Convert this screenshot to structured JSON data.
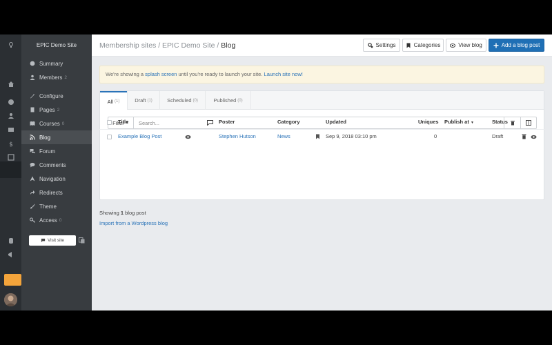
{
  "site": {
    "name": "EPIC Demo Site"
  },
  "breadcrumb": {
    "root": "Membership sites",
    "site": "EPIC Demo Site",
    "current": "Blog"
  },
  "toolbar": {
    "settings_label": "Settings",
    "categories_label": "Categories",
    "view_label": "View blog",
    "add_label": "Add a blog post"
  },
  "sidebar": {
    "items": [
      {
        "label": "Summary",
        "count": "",
        "icon": "globe-icon"
      },
      {
        "label": "Members",
        "count": "2",
        "icon": "users-icon"
      },
      {
        "label": "Configure",
        "count": "",
        "icon": "wrench-icon"
      },
      {
        "label": "Pages",
        "count": "2",
        "icon": "pages-icon"
      },
      {
        "label": "Courses",
        "count": "0",
        "icon": "courses-icon"
      },
      {
        "label": "Blog",
        "count": "",
        "icon": "rss-icon"
      },
      {
        "label": "Forum",
        "count": "",
        "icon": "forum-icon"
      },
      {
        "label": "Comments",
        "count": "",
        "icon": "comments-icon"
      },
      {
        "label": "Navigation",
        "count": "",
        "icon": "navigation-icon"
      },
      {
        "label": "Redirects",
        "count": "",
        "icon": "redirect-icon"
      },
      {
        "label": "Theme",
        "count": "",
        "icon": "brush-icon"
      },
      {
        "label": "Access",
        "count": "0",
        "icon": "key-icon"
      }
    ],
    "visit_label": "Visit site"
  },
  "notice": {
    "prefix": "We're showing a ",
    "link1": "splash screen",
    "middle": " until you're ready to launch your site. ",
    "link2": "Launch site now!"
  },
  "tabs": [
    {
      "label": "All",
      "count": "(1)"
    },
    {
      "label": "Draft",
      "count": "(1)"
    },
    {
      "label": "Scheduled",
      "count": "(0)"
    },
    {
      "label": "Published",
      "count": "(0)"
    }
  ],
  "filter": {
    "label": "Filter",
    "placeholder": "Search..."
  },
  "table": {
    "headers": {
      "title": "Title",
      "poster": "Poster",
      "category": "Category",
      "updated": "Updated",
      "uniques": "Uniques",
      "publish_at": "Publish at",
      "status": "Status"
    },
    "rows": [
      {
        "title": "Example Blog Post",
        "poster": "Stephen Hutson",
        "category": "News",
        "updated": "Sep 9, 2018 03:10 pm",
        "uniques": "0",
        "status": "Draft"
      }
    ]
  },
  "footer": {
    "showing_prefix": "Showing ",
    "showing_count": "1",
    "showing_suffix": " blog post",
    "import_label": "Import from a Wordpress blog"
  },
  "colors": {
    "accent": "#1f6fb5",
    "sidebar": "#383c40",
    "rail": "#2b2f33",
    "notice_bg": "#fbf5e1",
    "orange": "#f3a43b"
  }
}
